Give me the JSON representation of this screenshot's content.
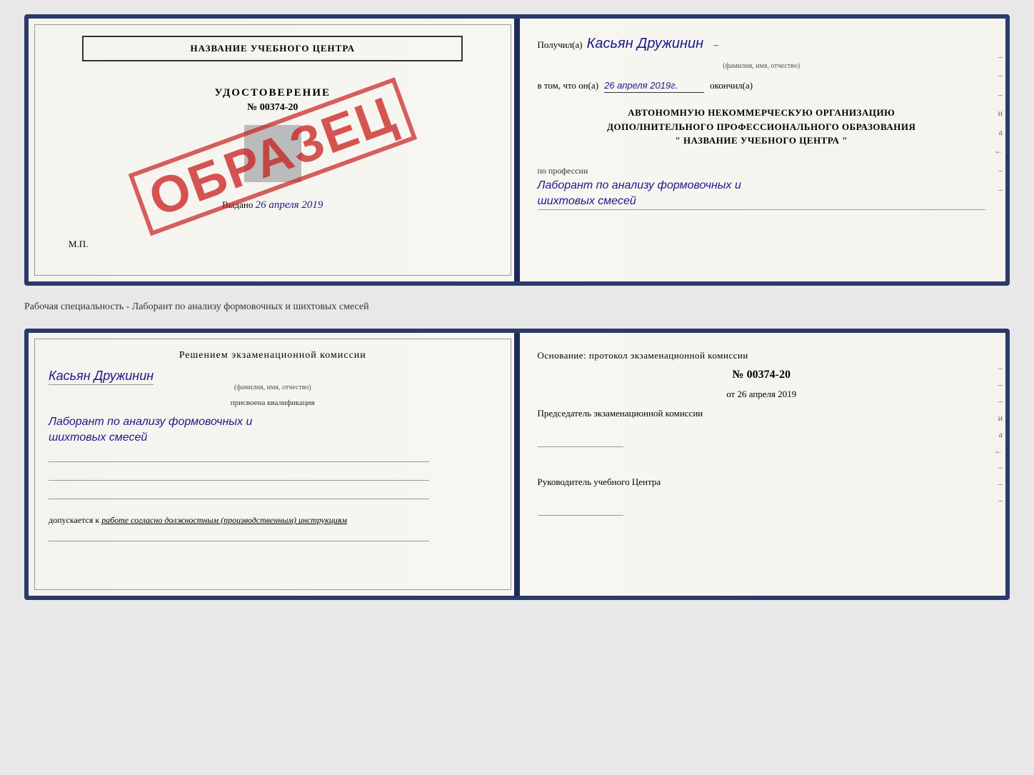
{
  "cert": {
    "left": {
      "title": "НАЗВАНИЕ УЧЕБНОГО ЦЕНТРА",
      "stamp": "ОБРАЗЕЦ",
      "udost_label": "УДОСТОВЕРЕНИЕ",
      "number": "№ 00374-20",
      "vydano": "Выдано",
      "vydano_date": "26 апреля 2019",
      "mp": "М.П."
    },
    "right": {
      "poluchil": "Получил(а)",
      "name_handwritten": "Касьян Дружинин",
      "fio_label": "(фамилия, имя, отчество)",
      "vtom_label": "в том, что он(а)",
      "date_handwritten": "26 апреля 2019г.",
      "okончил": "окончил(а)",
      "org_line1": "АВТОНОМНУЮ НЕКОММЕРЧЕСКУЮ ОРГАНИЗАЦИЮ",
      "org_line2": "ДОПОЛНИТЕЛЬНОГО ПРОФЕССИОНАЛЬНОГО ОБРАЗОВАНИЯ",
      "org_name": "\"  НАЗВАНИЕ УЧЕБНОГО ЦЕНТРА  \"",
      "po_professii": "по профессии",
      "prof_handwritten_line1": "Лаборант по анализу формовочных и",
      "prof_handwritten_line2": "шихтовых смесей"
    }
  },
  "middle": {
    "label": "Рабочая специальность - Лаборант по анализу формовочных и шихтовых смесей"
  },
  "qual": {
    "left": {
      "komissia_title": "Решением  экзаменационной  комиссии",
      "name_handwritten": "Касьян  Дружинин",
      "fio_label": "(фамилия, имя, отчество)",
      "prisvoena": "присвоена квалификация",
      "qual_line1": "Лаборант по анализу формовочных и",
      "qual_line2": "шихтовых смесей",
      "dopuskaetsya": "допускается к",
      "dopusk_italic": "работе согласно должностным (производственным) инструкциям"
    },
    "right": {
      "osnovanie": "Основание: протокол экзаменационной  комиссии",
      "protocol_number": "№  00374-20",
      "ot_label": "от",
      "ot_date": "26 апреля 2019",
      "predsedatel": "Председатель экзаменационной комиссии",
      "rukovod": "Руководитель учебного Центра",
      "side_dashes": [
        "-",
        "-",
        "-",
        "и",
        "а",
        "←",
        "-",
        "-",
        "-"
      ]
    }
  }
}
